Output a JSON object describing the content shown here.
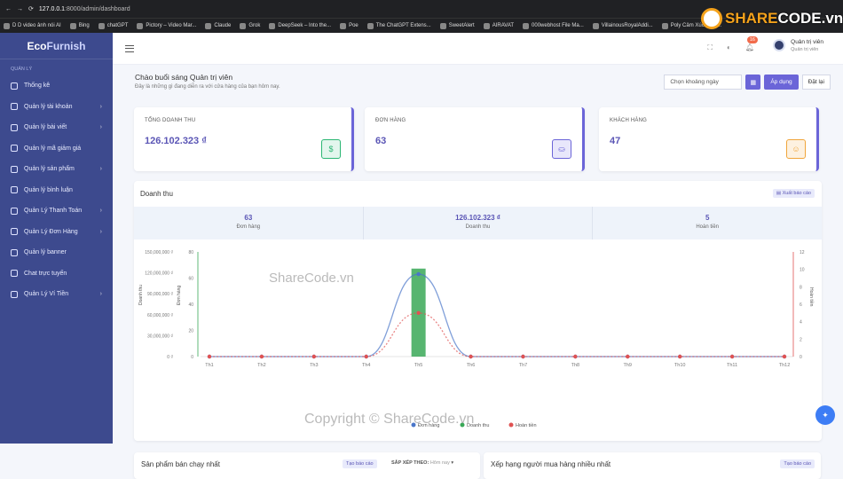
{
  "browser": {
    "url_host": "127.0.0.1",
    "url_path": ":8000/admin/dashboard"
  },
  "bookmarks": [
    "D D video ảnh nói AI",
    "Bing",
    "chatGPT",
    "Pictory – Video Mar...",
    "Claude",
    "Grok",
    "DeepSeek – Into the...",
    "Poe",
    "The ChatGPT Extens...",
    "SweetAlert",
    "AIRAVAT",
    "000webhost File Ma...",
    "VillainousRoyalAddi...",
    "Poly Cảm Xúc - Đối..."
  ],
  "sidebar": {
    "brand_a": "Eco",
    "brand_b": "Furnish",
    "section": "QUẢN LÝ",
    "items": [
      {
        "label": "Thống kê",
        "chev": false
      },
      {
        "label": "Quản lý tài khoản",
        "chev": true
      },
      {
        "label": "Quản lý bài viết",
        "chev": true
      },
      {
        "label": "Quản lý mã giảm giá",
        "chev": false
      },
      {
        "label": "Quản lý sản phẩm",
        "chev": true
      },
      {
        "label": "Quản lý bình luận",
        "chev": false
      },
      {
        "label": "Quản Lý Thanh Toán",
        "chev": true
      },
      {
        "label": "Quản Lý Đơn Hàng",
        "chev": true
      },
      {
        "label": "Quản lý banner",
        "chev": false
      },
      {
        "label": "Chat trực tuyến",
        "chev": false
      },
      {
        "label": "Quản Lý Ví Tiền",
        "chev": true
      }
    ]
  },
  "topbar": {
    "notif_count": "16",
    "user_name": "Quản trị viên",
    "user_role": "Quản trị viên"
  },
  "greeting": {
    "title": "Chào buổi sáng Quản trị viên",
    "subtitle": "Đây là những gì đang diễn ra với cửa hàng của bạn hôm nay."
  },
  "filter": {
    "date_placeholder": "Chọn khoảng ngày",
    "apply": "Áp dụng",
    "reset": "Đặt lại"
  },
  "stats": [
    {
      "title": "TỔNG DOANH THU",
      "value": "126.102.323 ₫",
      "icon": "dollar-icon",
      "color": "#2bb673",
      "bg": "#e3f6ed"
    },
    {
      "title": "ĐƠN HÀNG",
      "value": "63",
      "icon": "bag-icon",
      "color": "#6b65d8",
      "bg": "#e8e7fb"
    },
    {
      "title": "KHÁCH HÀNG",
      "value": "47",
      "icon": "user-icon",
      "color": "#f0a53b",
      "bg": "#fdf1e0"
    }
  ],
  "revenue": {
    "title": "Doanh thu",
    "export": "Xuất báo cáo",
    "summary": [
      {
        "value": "63",
        "label": "Đơn hàng"
      },
      {
        "value": "126.102.323 ₫",
        "label": "Doanh thu"
      },
      {
        "value": "5",
        "label": "Hoàn tiền"
      }
    ]
  },
  "chart_data": {
    "type": "bar",
    "categories": [
      "Th1",
      "Th2",
      "Th3",
      "Th4",
      "Th5",
      "Th6",
      "Th7",
      "Th8",
      "Th9",
      "Th10",
      "Th11",
      "Th12"
    ],
    "series": [
      {
        "name": "Đơn hàng",
        "type": "line",
        "axis": "orders",
        "color": "#4a76c9",
        "values": [
          0,
          0,
          0,
          0,
          63,
          0,
          0,
          0,
          0,
          0,
          0,
          0
        ]
      },
      {
        "name": "Doanh thu",
        "type": "bar",
        "axis": "revenue",
        "color": "#3aa857",
        "values": [
          0,
          0,
          0,
          0,
          126102323,
          0,
          0,
          0,
          0,
          0,
          0,
          0
        ]
      },
      {
        "name": "Hoàn tiền",
        "type": "line",
        "axis": "refunds",
        "color": "#e05252",
        "values": [
          0,
          0,
          0,
          0,
          5,
          0,
          0,
          0,
          0,
          0,
          0,
          0
        ]
      }
    ],
    "axes": {
      "revenue": {
        "ticks": [
          "150,000,000 ₫",
          "120,000,000 ₫",
          "90,000,000 ₫",
          "60,000,000 ₫",
          "30,000,000 ₫",
          "0 ₫"
        ],
        "ylim": [
          0,
          150000000
        ],
        "label": "Doanh thu"
      },
      "orders": {
        "ticks": [
          "80",
          "60",
          "40",
          "20",
          "0"
        ],
        "ylim": [
          0,
          80
        ],
        "label": "Đơn hàng"
      },
      "refunds": {
        "ticks": [
          "12",
          "10",
          "8",
          "6",
          "4",
          "2",
          "0"
        ],
        "ylim": [
          0,
          12
        ],
        "label": "Hoàn tiền"
      }
    },
    "legend": "bottom"
  },
  "bottom": {
    "best_products": "Sản phẩm bán chạy nhất",
    "create_report": "Tạo báo cáo",
    "sort_label": "SẮP XẾP THEO:",
    "sort_value": "Hôm nay",
    "top_buyers": "Xếp hạng người mua hàng nhiều nhất",
    "create_report2": "Tạo báo cáo"
  },
  "watermark": {
    "top": "ShareCode.vn",
    "bottom": "Copyright © ShareCode.vn",
    "logo_a": "SHARE",
    "logo_b": "CODE.vn"
  }
}
